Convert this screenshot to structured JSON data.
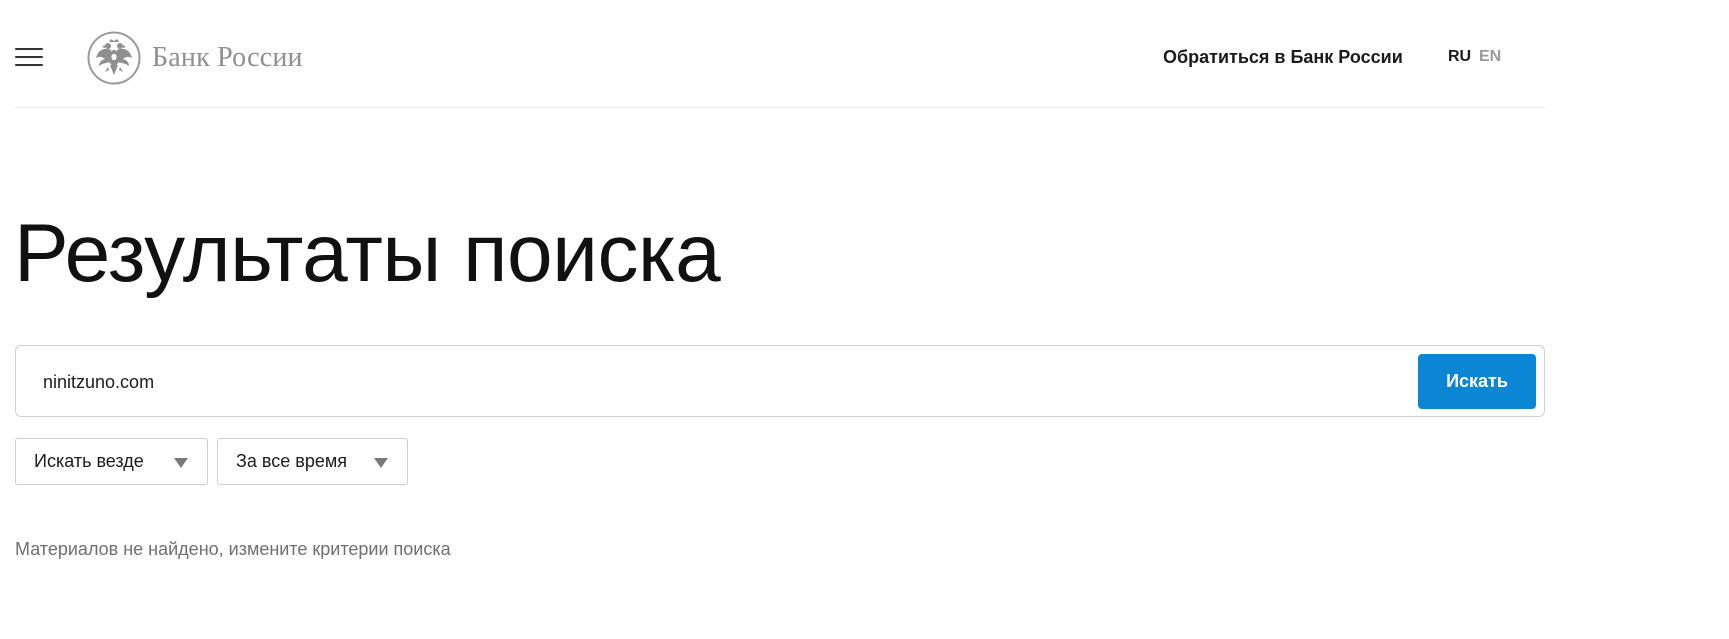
{
  "header": {
    "menu_icon": "hamburger-menu-icon",
    "logo_icon": "double-headed-eagle-emblem-icon",
    "logo_text": "Банк России",
    "contact_link": "Обратиться в Банк России",
    "languages": [
      {
        "code": "RU",
        "active": true
      },
      {
        "code": "EN",
        "active": false
      }
    ]
  },
  "page_title": "Результаты поиска",
  "search": {
    "value": "ninitzuno.com",
    "button_label": "Искать",
    "button_color": "#0b86d4"
  },
  "filters": {
    "where": {
      "selected": "Искать везде",
      "icon": "dropdown-arrow-icon"
    },
    "when": {
      "selected": "За все время",
      "icon": "dropdown-arrow-icon"
    }
  },
  "results": {
    "empty_message": "Материалов не найдено, измените критерии поиска"
  },
  "colors": {
    "accent": "#0b86d4",
    "muted_text": "#6f6f6f",
    "logo_gray": "#8f8f8f"
  }
}
